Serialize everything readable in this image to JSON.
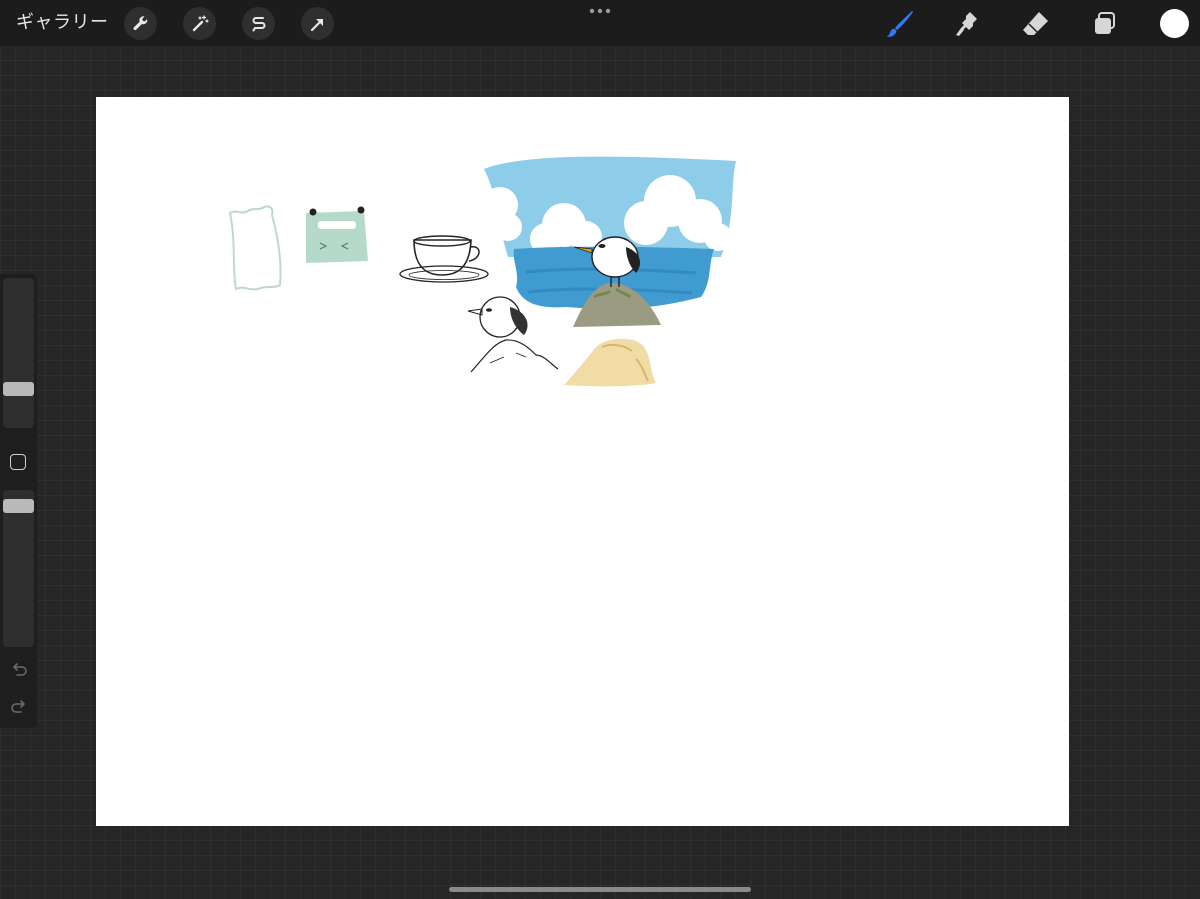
{
  "toolbar": {
    "gallery_label": "ギャラリー",
    "left_tools": [
      {
        "icon": "wrench-icon"
      },
      {
        "icon": "magic-wand-icon"
      },
      {
        "icon": "selection-icon"
      },
      {
        "icon": "transform-arrow-icon"
      }
    ],
    "right_tools": [
      {
        "icon": "brush-icon",
        "active": true
      },
      {
        "icon": "smudge-icon"
      },
      {
        "icon": "eraser-icon"
      },
      {
        "icon": "layers-icon"
      }
    ],
    "active_color": "#ffffff",
    "accent_color": "#2f7bf5"
  },
  "sidebar": {
    "brush_size": 0.3,
    "opacity": 0.95
  }
}
